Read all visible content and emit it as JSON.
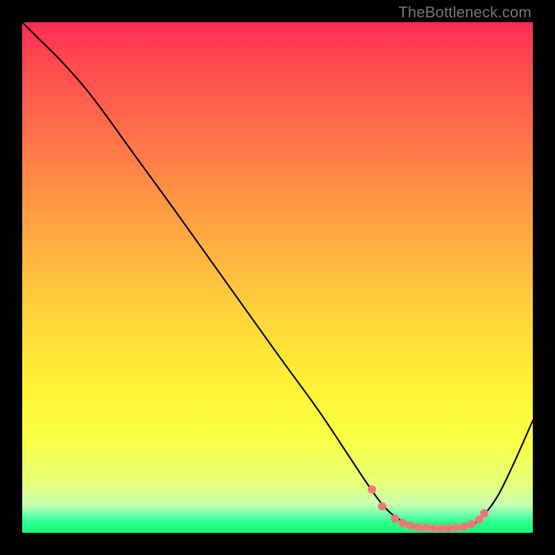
{
  "watermark": "TheBottleneck.com",
  "colors": {
    "frame": "#000000",
    "curve": "#000000",
    "dot_fill": "#f07878",
    "gradient_top": "#ff2a55",
    "gradient_bottom": "#1aff7a"
  },
  "chart_data": {
    "type": "line",
    "title": "",
    "xlabel": "",
    "ylabel": "",
    "xlim": [
      0,
      100
    ],
    "ylim": [
      0,
      100
    ],
    "grid": false,
    "legend": false,
    "series": [
      {
        "name": "bottleneck-curve",
        "x": [
          0,
          3,
          8,
          14,
          22,
          30,
          40,
          50,
          58,
          64,
          68,
          71,
          74,
          77,
          80,
          83,
          86,
          88,
          90,
          93,
          96,
          100
        ],
        "y": [
          100,
          97,
          92,
          85,
          74,
          63,
          49,
          35,
          24,
          15,
          9,
          5,
          2.5,
          1.3,
          0.9,
          0.8,
          1.0,
          1.6,
          3.0,
          7,
          13,
          22
        ]
      }
    ],
    "highlight_points": {
      "name": "optimal-zone-dots",
      "x": [
        68.5,
        70.5,
        73,
        74.5,
        76,
        77.5,
        79,
        80.5,
        82,
        83.5,
        85,
        86.5,
        88,
        89.5,
        90.5
      ],
      "y": [
        8.5,
        5.2,
        2.8,
        1.9,
        1.4,
        1.1,
        1.0,
        0.9,
        0.9,
        0.9,
        1.0,
        1.2,
        1.7,
        2.6,
        3.8
      ]
    }
  }
}
